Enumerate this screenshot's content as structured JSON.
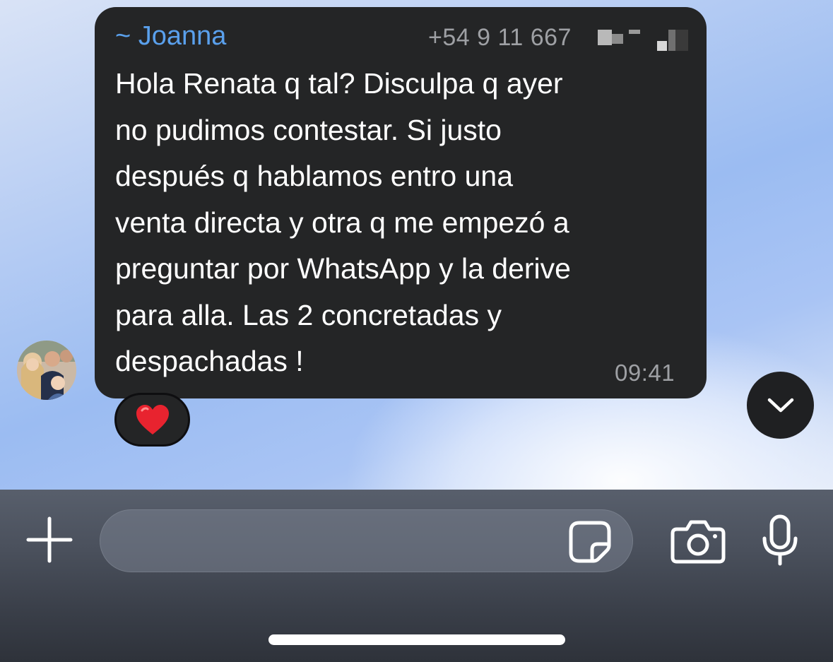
{
  "message": {
    "sender_name": "~ Joanna",
    "sender_phone": "+54 9 11 667",
    "text": "Hola Renata q tal? Disculpa q ayer\nno pudimos contestar.  Si justo\ndespués q hablamos entro una\nventa directa y otra q me empezó a\npreguntar por WhatsApp y la derive\npara alla. Las 2 concretadas y\ndespachadas !",
    "time": "09:41",
    "reaction_emoji": "❤️"
  },
  "composer": {
    "input_value": "",
    "input_placeholder": ""
  },
  "icons": {
    "attach": "plus-icon",
    "sticker": "sticker-icon",
    "camera": "camera-icon",
    "microphone": "microphone-icon",
    "scroll": "chevron-down-icon"
  },
  "colors": {
    "sender_name": "#5aa0ec",
    "bubble": "#242526",
    "meta_text": "#9ea0a4",
    "reaction_heart": "#e8232f"
  }
}
